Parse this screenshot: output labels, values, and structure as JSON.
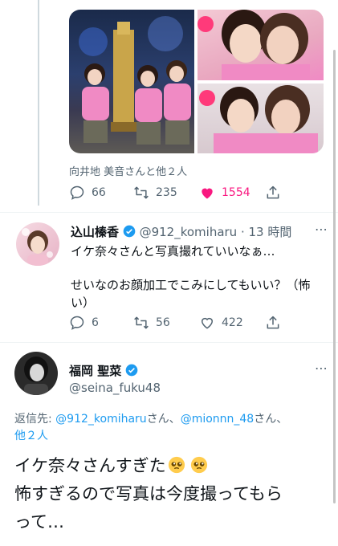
{
  "tweet1": {
    "liked_by": "向井地 美音さんと他２人",
    "stats": {
      "replies": "66",
      "retweets": "235",
      "likes": "1554"
    }
  },
  "reply1": {
    "author_name": "込山榛香",
    "handle_time": "@912_komiharu · 13 時間",
    "text_line1": "イケ奈々さんと写真撮れていいなぁ…",
    "text_line2": "せいなのお顔加工でこみにしてもいい？（怖",
    "text_line3": "い）",
    "stats": {
      "replies": "6",
      "retweets": "56",
      "likes": "422"
    }
  },
  "main_tweet": {
    "author_name": "福岡 聖菜",
    "handle": "@seina_fuku48",
    "reply_prefix": "返信先: ",
    "reply_mention1": "@912_komiharu",
    "reply_sep1": "さん、",
    "reply_mention2": "@mionnn_48",
    "reply_sep2": "さん、",
    "reply_others": "他２人",
    "text_line1": "イケ奈々さんすぎた",
    "text_line2": "怖すぎるので写真は今度撮ってもら",
    "text_line3": "って…"
  },
  "colors": {
    "accent": "#1d9bf0",
    "like": "#f91880",
    "muted": "#536471"
  },
  "icons": [
    "reply-icon",
    "retweet-icon",
    "heart-icon",
    "share-icon",
    "verified-badge-icon",
    "more-icon",
    "pleading-face-emoji"
  ]
}
